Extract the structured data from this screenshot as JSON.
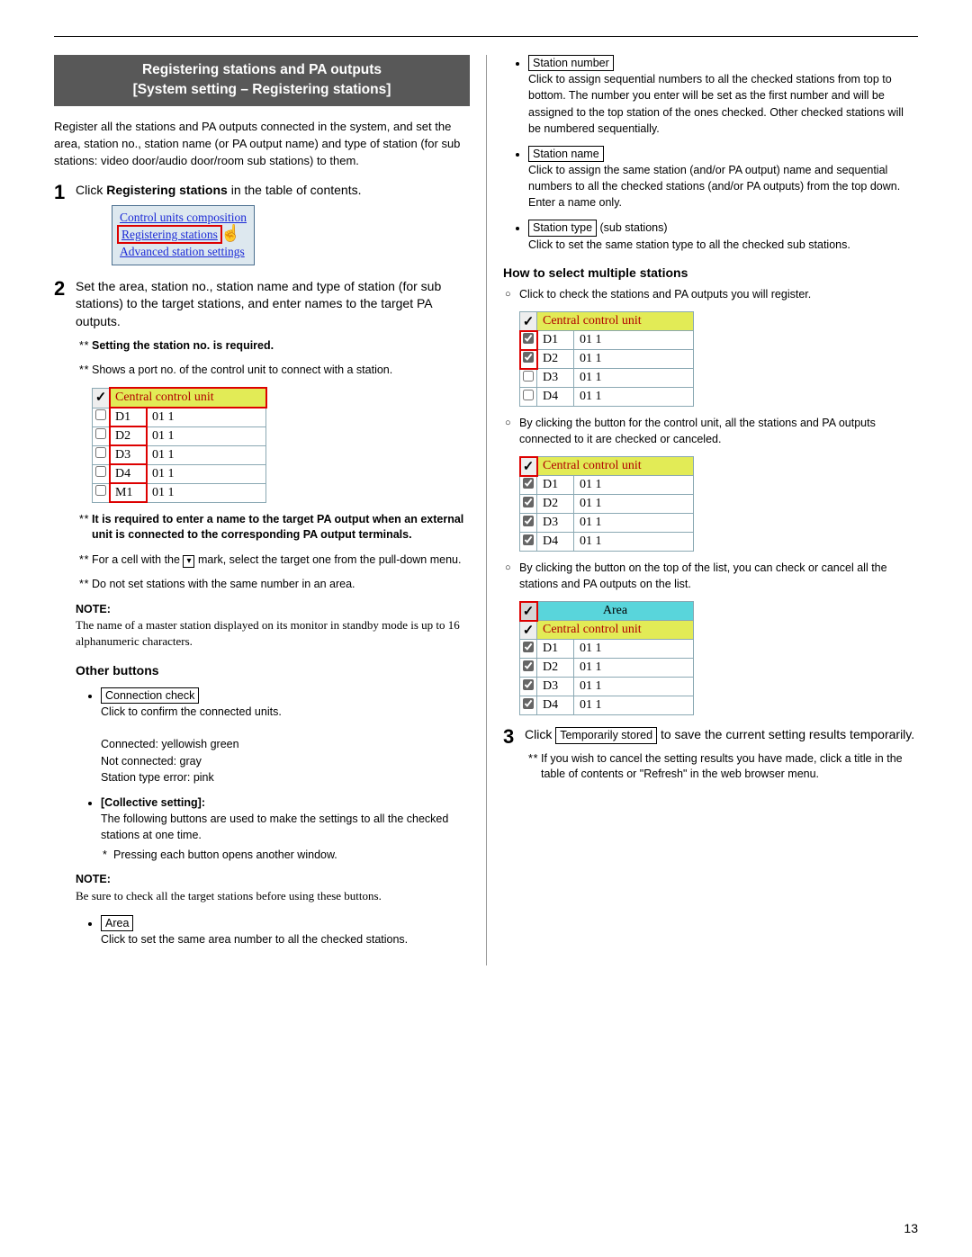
{
  "pageNumber": "13",
  "sectionTitleLine1": "Registering stations and PA outputs",
  "sectionTitleLine2": "[System setting – Registering stations]",
  "intro": "Register all the stations and PA outputs connected in the system, and set the area, station no., station name (or PA output name) and type of station (for sub stations: video door/audio door/room sub stations) to them.",
  "step1": {
    "textBefore": "Click ",
    "bold": "Registering stations",
    "textAfter": " in the table of contents."
  },
  "toc": {
    "line1": "Control units composition",
    "line2": "Registering stations",
    "line3": "Advanced station settings"
  },
  "step2": {
    "text": "Set the area, station no., station name and type of station (for sub stations) to the target stations, and enter names to the target PA outputs.",
    "sub1": "Setting the station no. is required.",
    "sub2": "Shows a port no. of the control unit to connect with a station.",
    "sub3": "It is required to enter a name to the target PA output when an external unit is connected to the corresponding PA output terminals.",
    "sub4_before": "For a cell with the ",
    "sub4_after": " mark, select the target one from the pull-down menu.",
    "sub5": "Do not set stations with the same number in an area."
  },
  "noteLabel": "NOTE:",
  "note1": "The name of a master station displayed on its monitor in standby mode is up to 16 alphanumeric characters.",
  "otherButtonsHeading": "Other buttons",
  "buttons": {
    "connectionCheck": {
      "label": "Connection check",
      "desc": "Click to confirm the connected units.",
      "line1": "Connected: yellowish green",
      "line2": "Not connected: gray",
      "line3": "Station type error: pink"
    },
    "collective": {
      "heading": "[Collective setting]:",
      "desc": "The following buttons are used to make the settings to all the checked stations at one time.",
      "sub": "Pressing each button opens another window."
    },
    "note2": "Be sure to check all the target stations before using these buttons.",
    "area": {
      "label": "Area",
      "desc": "Click to set the same area number to all the checked stations."
    },
    "stationNumber": {
      "label": "Station number",
      "desc": "Click to assign sequential numbers to all the checked stations from top to bottom. The number you enter will be set as the first number and will be assigned to the top station of the ones checked. Other checked stations will be numbered sequentially."
    },
    "stationName": {
      "label": "Station name",
      "desc": "Click to assign the same station (and/or PA output) name and sequential numbers to all the checked stations (and/or PA outputs) from the top down. Enter a name only."
    },
    "stationType": {
      "label": "Station type",
      "suffix": "(sub stations)",
      "desc": "Click to set the same station type to all the checked sub stations."
    }
  },
  "selectHeading": "How to select multiple stations",
  "sel1": "Click to check the stations and PA outputs you will register.",
  "sel2": "By clicking the button for the control unit, all the stations and PA outputs connected to it are checked or canceled.",
  "sel3": "By clicking the button on the top of the list, you can check or cancel all the stations and PA outputs on the list.",
  "step3": {
    "textBefore": "Click ",
    "boxed": "Temporarily stored",
    "textAfter": " to save the current setting results temporarily.",
    "sub": "If you wish to cancel the setting results you have made, click a title in the table of contents or \"Refresh\" in the web browser menu."
  },
  "table": {
    "header": "Central control unit",
    "areaHeader": "Area",
    "rows": [
      {
        "id": "D1",
        "val": "01 1"
      },
      {
        "id": "D2",
        "val": "01 1"
      },
      {
        "id": "D3",
        "val": "01 1"
      },
      {
        "id": "D4",
        "val": "01 1"
      }
    ],
    "m1": {
      "id": "M1",
      "val": "01 1"
    }
  }
}
